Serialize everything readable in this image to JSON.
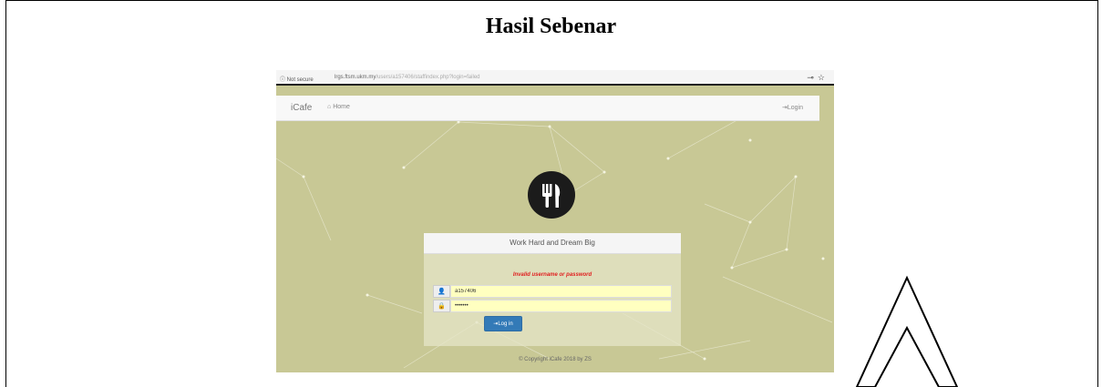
{
  "document": {
    "title": "Hasil Sebenar"
  },
  "browser": {
    "security_label": "ⓘ Not secure",
    "url_host": "lrgs.ftsm.ukm.my",
    "url_path": "/users/a157406/staffindex.php?login=failed",
    "icons": [
      "key-icon",
      "star-icon"
    ]
  },
  "navbar": {
    "brand": "iCafe",
    "home_label": "Home",
    "login_label": "Login"
  },
  "login_panel": {
    "heading": "Work Hard and Dream Big",
    "error_message": "Invalid username or password",
    "username_value": "a157406",
    "password_value": "•••••••",
    "submit_label": "Log in"
  },
  "footer": {
    "copyright": "© Copyright iCafe 2018 by ZS"
  },
  "colors": {
    "background": "#c8c895",
    "primary_button": "#337ab7",
    "error": "#e02020",
    "input_autofill": "#ffffc0"
  }
}
